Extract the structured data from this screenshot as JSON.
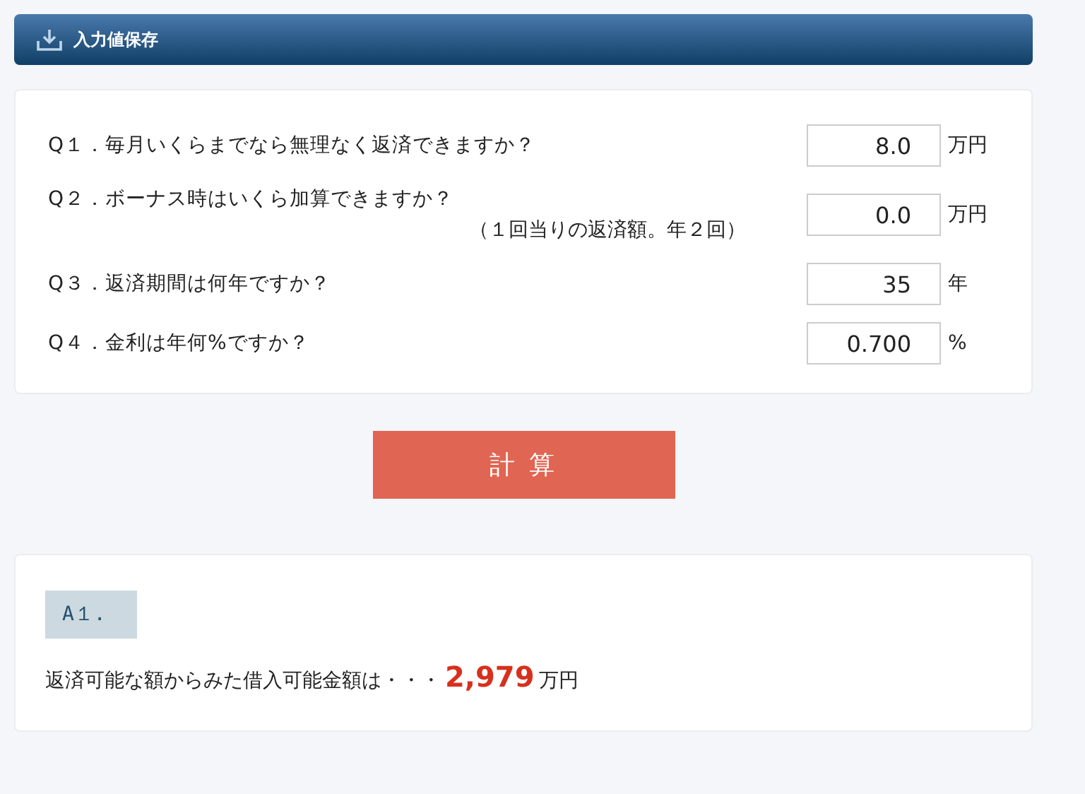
{
  "header": {
    "title": "入力値保存"
  },
  "questions": [
    {
      "label": "Q１．毎月いくらまでなら無理なく返済できますか？",
      "value": "8.0",
      "unit": "万円"
    },
    {
      "label": "Q２．ボーナス時はいくら加算できますか？",
      "note": "（１回当りの返済額。年２回）",
      "value": "0.0",
      "unit": "万円"
    },
    {
      "label": "Q３．返済期間は何年ですか？",
      "value": "35",
      "unit": "年"
    },
    {
      "label": "Q４．金利は年何%ですか？",
      "value": "0.700",
      "unit": "%"
    }
  ],
  "calculate_button": "計 算",
  "answer": {
    "tag": "A１.",
    "text": "返済可能な額からみた借入可能金額は・・・",
    "amount": "2,979",
    "unit": "万円"
  }
}
